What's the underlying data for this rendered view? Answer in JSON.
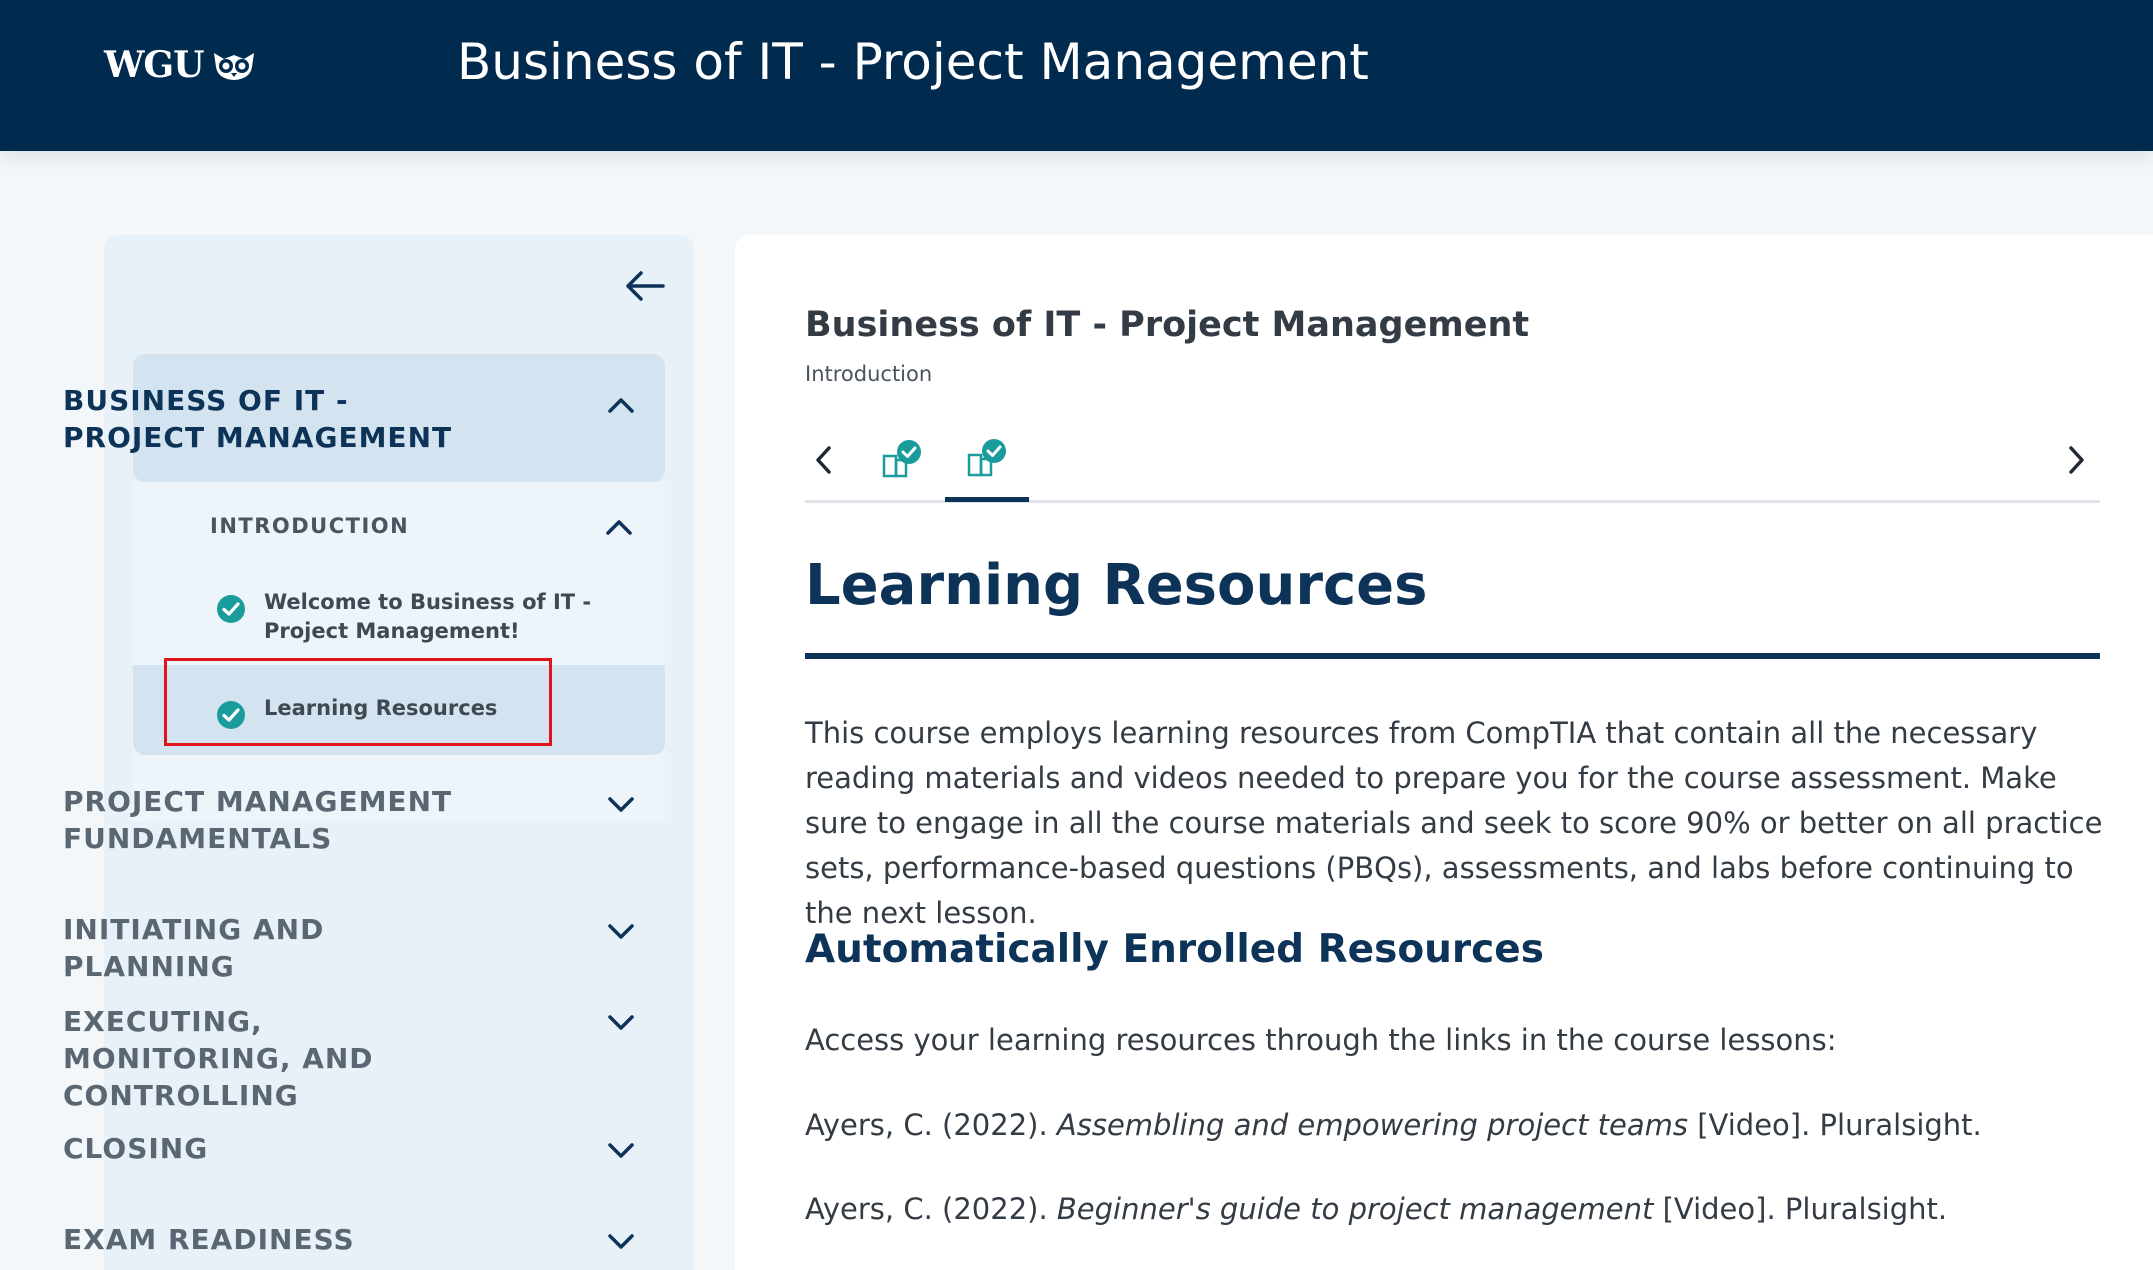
{
  "header": {
    "logo_text": "WGU",
    "title": "Business of IT - Project Management"
  },
  "sidebar": {
    "sections": [
      {
        "label": "BUSINESS OF IT - PROJECT MANAGEMENT",
        "expanded": true
      },
      {
        "label": "PROJECT MANAGEMENT FUNDAMENTALS",
        "expanded": false
      },
      {
        "label": "INITIATING AND PLANNING",
        "expanded": false
      },
      {
        "label": "EXECUTING, MONITORING, AND CONTROLLING",
        "expanded": false
      },
      {
        "label": "CLOSING",
        "expanded": false
      },
      {
        "label": "EXAM READINESS",
        "expanded": false
      }
    ],
    "subsection": {
      "label": "INTRODUCTION"
    },
    "lessons": [
      {
        "label": "Welcome to Business of IT - Project Management!",
        "completed": true
      },
      {
        "label": "Learning Resources",
        "completed": true,
        "active": true
      }
    ]
  },
  "main": {
    "course_title": "Business of IT - Project Management",
    "course_subtitle": "Introduction",
    "lesson_title": "Learning Resources",
    "intro_paragraph": "This course employs learning resources from CompTIA that contain all the necessary reading materials and videos needed to prepare you for the course assessment. Make sure to engage in all the course materials and seek to score 90% or better on all practice sets, performance-based questions (PBQs), assessments, and labs before continuing to the next lesson.",
    "section_heading": "Automatically Enrolled Resources",
    "access_text": "Access your learning resources through the links in the course lessons:",
    "references": [
      {
        "prefix": "Ayers, C. (2022). ",
        "title": "Assembling and empowering project teams",
        "suffix": " [Video]. Pluralsight."
      },
      {
        "prefix": "Ayers, C. (2022). ",
        "title": "Beginner's guide to project management",
        "suffix": " [Video]. Pluralsight."
      }
    ]
  },
  "colors": {
    "header_bg": "#002a4e",
    "accent_navy": "#0d3358",
    "check_teal": "#1a9c9c",
    "highlight_red": "#e0141a"
  },
  "icons": {
    "collapse": "arrow-left-icon",
    "expanded": "chevron-up-icon",
    "collapsed": "chevron-down-icon",
    "completed": "check-circle-icon",
    "step": "reading-complete-icon",
    "prev": "chevron-left-icon",
    "next": "chevron-right-icon"
  }
}
